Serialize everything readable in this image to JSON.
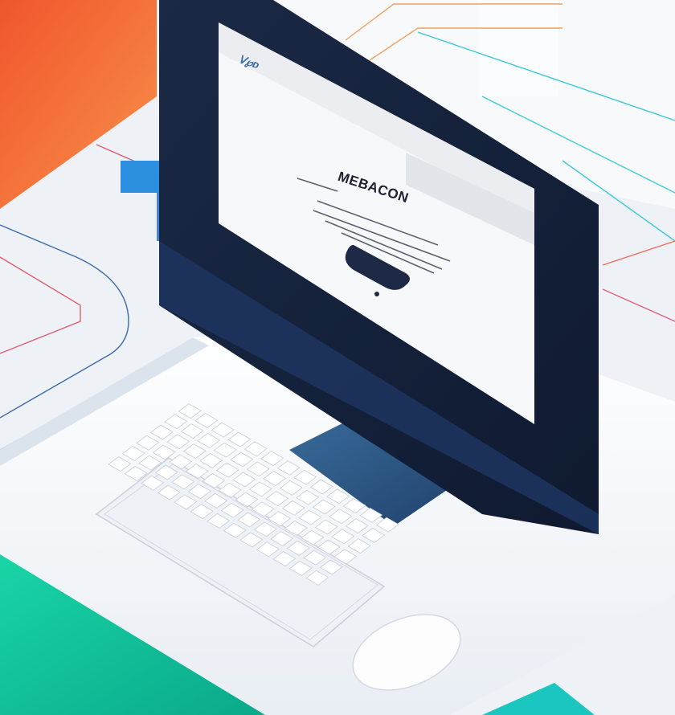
{
  "screen": {
    "logo_text": "ᐯ℘ᴅ",
    "headline": "MEBACON"
  },
  "colors": {
    "orange": "#f26a3c",
    "teal": "#1fd3b0",
    "navy": "#16223c",
    "accent_line": "#f0a060",
    "cyan_line": "#3bc9d9"
  },
  "icons": [
    "keyboard",
    "mouse",
    "monitor"
  ]
}
